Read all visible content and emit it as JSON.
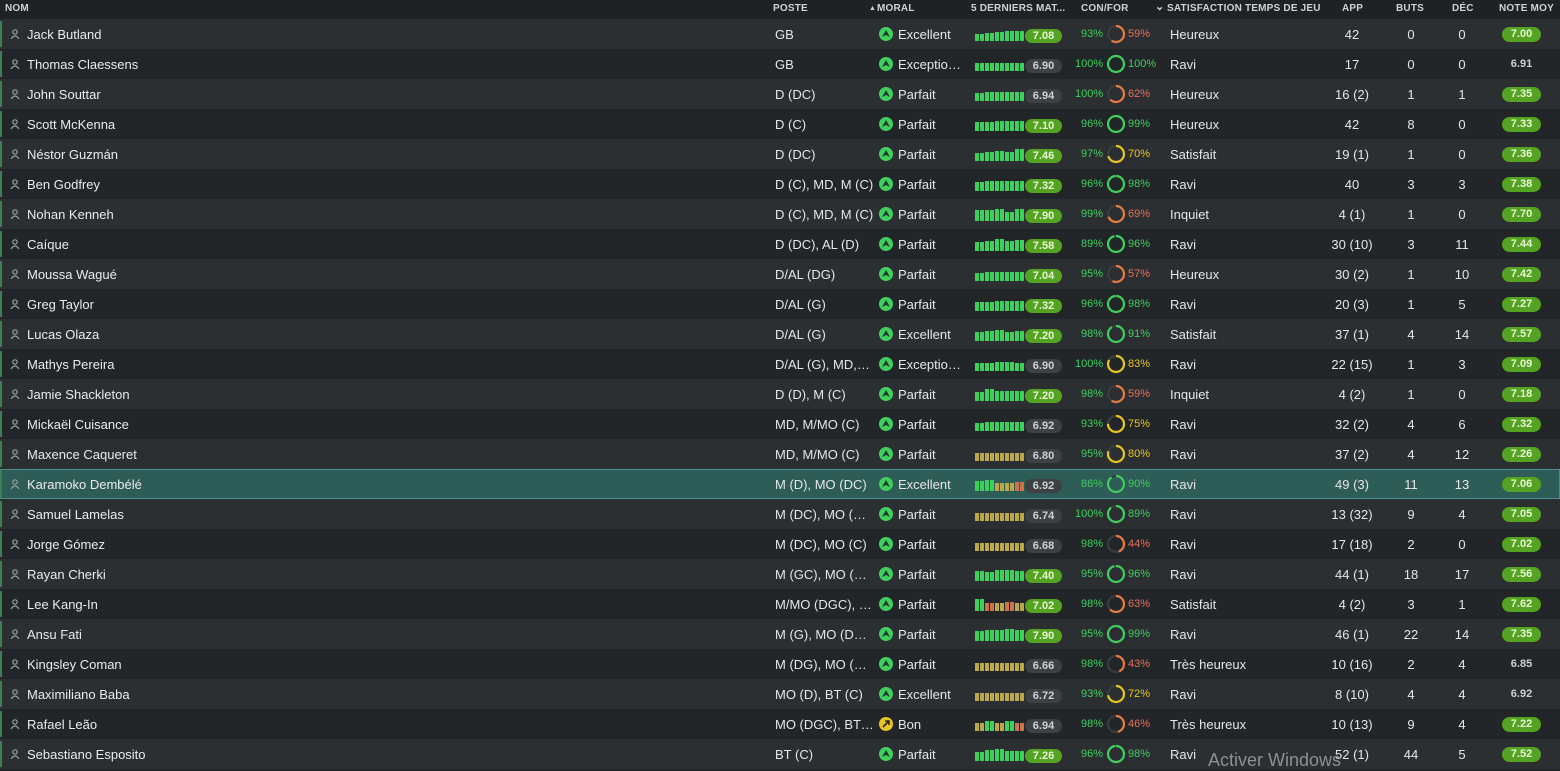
{
  "header": {
    "name": "NOM",
    "position": "POSTE",
    "morale": "MORAL",
    "morale_sort": "▲",
    "last5": "5 DERNIERS MAT...",
    "confor": "CON/FOR",
    "satisfaction_sort": "⌄",
    "satisfaction": "SATISFACTION TEMPS DE JEU",
    "apps": "APP",
    "goals": "BUTS",
    "assists": "DÉC",
    "avg": "NOTE MOY"
  },
  "colors": {
    "good": "#54a322",
    "ring_green": "#3fcf5e",
    "ring_orange": "#e87a43",
    "ring_yellow": "#e6c523"
  },
  "players": [
    {
      "name": "Jack Butland",
      "pos": "GB",
      "morale": "Excellent",
      "morale_icon": "morale-up-icon",
      "form": "7.08",
      "form_good": true,
      "bars": [
        [
          "g",
          7
        ],
        [
          "g",
          8
        ],
        [
          "g",
          9
        ],
        [
          "g",
          10
        ],
        [
          "g",
          10
        ]
      ],
      "con": "93%",
      "fit": "59%",
      "fit_level": 59,
      "sat": "Heureux",
      "app": "42",
      "goals": "0",
      "ast": "0",
      "avg": "7.00",
      "avg_good": true
    },
    {
      "name": "Thomas Claessens",
      "pos": "GB",
      "morale": "Exception…",
      "morale_icon": "morale-up-icon",
      "form": "6.90",
      "form_good": false,
      "bars": [
        [
          "g",
          8
        ],
        [
          "g",
          8
        ],
        [
          "g",
          8
        ],
        [
          "g",
          8
        ],
        [
          "g",
          8
        ]
      ],
      "con": "100%",
      "fit": "100%",
      "fit_level": 100,
      "sat": "Ravi",
      "app": "17",
      "goals": "0",
      "ast": "0",
      "avg": "6.91",
      "avg_good": false
    },
    {
      "name": "John Souttar",
      "pos": "D (DC)",
      "morale": "Parfait",
      "morale_icon": "morale-up-icon",
      "form": "6.94",
      "form_good": false,
      "bars": [
        [
          "g",
          8
        ],
        [
          "g",
          9
        ],
        [
          "g",
          9
        ],
        [
          "g",
          9
        ],
        [
          "g",
          9
        ]
      ],
      "con": "100%",
      "fit": "62%",
      "fit_level": 62,
      "sat": "Heureux",
      "app": "16 (2)",
      "goals": "1",
      "ast": "1",
      "avg": "7.35",
      "avg_good": true
    },
    {
      "name": "Scott McKenna",
      "pos": "D (C)",
      "morale": "Parfait",
      "morale_icon": "morale-up-icon",
      "form": "7.10",
      "form_good": true,
      "bars": [
        [
          "g",
          9
        ],
        [
          "g",
          9
        ],
        [
          "g",
          10
        ],
        [
          "g",
          10
        ],
        [
          "g",
          10
        ]
      ],
      "con": "96%",
      "fit": "99%",
      "fit_level": 99,
      "sat": "Heureux",
      "app": "42",
      "goals": "8",
      "ast": "0",
      "avg": "7.33",
      "avg_good": true
    },
    {
      "name": "Néstor Guzmán",
      "pos": "D (DC)",
      "morale": "Parfait",
      "morale_icon": "morale-up-icon",
      "form": "7.46",
      "form_good": true,
      "bars": [
        [
          "g",
          8
        ],
        [
          "g",
          9
        ],
        [
          "g",
          10
        ],
        [
          "g",
          9
        ],
        [
          "g",
          12
        ]
      ],
      "con": "97%",
      "fit": "70%",
      "fit_level": 70,
      "sat": "Satisfait",
      "app": "19 (1)",
      "goals": "1",
      "ast": "0",
      "avg": "7.36",
      "avg_good": true
    },
    {
      "name": "Ben Godfrey",
      "pos": "D (C), MD, M (C)",
      "morale": "Parfait",
      "morale_icon": "morale-up-icon",
      "form": "7.32",
      "form_good": true,
      "bars": [
        [
          "g",
          9
        ],
        [
          "g",
          10
        ],
        [
          "g",
          10
        ],
        [
          "g",
          10
        ],
        [
          "g",
          10
        ]
      ],
      "con": "96%",
      "fit": "98%",
      "fit_level": 98,
      "sat": "Ravi",
      "app": "40",
      "goals": "3",
      "ast": "3",
      "avg": "7.38",
      "avg_good": true
    },
    {
      "name": "Nohan Kenneh",
      "pos": "D (C), MD, M (C)",
      "morale": "Parfait",
      "morale_icon": "morale-up-icon",
      "form": "7.90",
      "form_good": true,
      "bars": [
        [
          "g",
          11
        ],
        [
          "g",
          11
        ],
        [
          "g",
          12
        ],
        [
          "g",
          9
        ],
        [
          "g",
          12
        ]
      ],
      "con": "99%",
      "fit": "69%",
      "fit_level": 69,
      "sat": "Inquiet",
      "app": "4 (1)",
      "goals": "1",
      "ast": "0",
      "avg": "7.70",
      "avg_good": true
    },
    {
      "name": "Caíque",
      "pos": "D (DC), AL (D)",
      "morale": "Parfait",
      "morale_icon": "morale-up-icon",
      "form": "7.58",
      "form_good": true,
      "bars": [
        [
          "g",
          9
        ],
        [
          "g",
          10
        ],
        [
          "g",
          12
        ],
        [
          "g",
          10
        ],
        [
          "g",
          11
        ]
      ],
      "con": "89%",
      "fit": "96%",
      "fit_level": 96,
      "sat": "Ravi",
      "app": "30 (10)",
      "goals": "3",
      "ast": "11",
      "avg": "7.44",
      "avg_good": true
    },
    {
      "name": "Moussa Wagué",
      "pos": "D/AL (DG)",
      "morale": "Parfait",
      "morale_icon": "morale-up-icon",
      "form": "7.04",
      "form_good": true,
      "bars": [
        [
          "g",
          8
        ],
        [
          "g",
          9
        ],
        [
          "g",
          9
        ],
        [
          "g",
          9
        ],
        [
          "g",
          9
        ]
      ],
      "con": "95%",
      "fit": "57%",
      "fit_level": 57,
      "sat": "Heureux",
      "app": "30 (2)",
      "goals": "1",
      "ast": "10",
      "avg": "7.42",
      "avg_good": true
    },
    {
      "name": "Greg Taylor",
      "pos": "D/AL (G)",
      "morale": "Parfait",
      "morale_icon": "morale-up-icon",
      "form": "7.32",
      "form_good": true,
      "bars": [
        [
          "g",
          9
        ],
        [
          "g",
          9
        ],
        [
          "g",
          10
        ],
        [
          "g",
          10
        ],
        [
          "g",
          10
        ]
      ],
      "con": "96%",
      "fit": "98%",
      "fit_level": 98,
      "sat": "Ravi",
      "app": "20 (3)",
      "goals": "1",
      "ast": "5",
      "avg": "7.27",
      "avg_good": true
    },
    {
      "name": "Lucas Olaza",
      "pos": "D/AL (G)",
      "morale": "Excellent",
      "morale_icon": "morale-up-icon",
      "form": "7.20",
      "form_good": true,
      "bars": [
        [
          "g",
          9
        ],
        [
          "g",
          10
        ],
        [
          "g",
          11
        ],
        [
          "g",
          9
        ],
        [
          "g",
          10
        ]
      ],
      "con": "98%",
      "fit": "91%",
      "fit_level": 91,
      "sat": "Satisfait",
      "app": "37 (1)",
      "goals": "4",
      "ast": "14",
      "avg": "7.57",
      "avg_good": true
    },
    {
      "name": "Mathys Pereira",
      "pos": "D/AL (G), MD,…",
      "morale": "Exception…",
      "morale_icon": "morale-up-icon",
      "form": "6.90",
      "form_good": false,
      "bars": [
        [
          "g",
          8
        ],
        [
          "g",
          8
        ],
        [
          "g",
          9
        ],
        [
          "g",
          9
        ],
        [
          "g",
          8
        ]
      ],
      "con": "100%",
      "fit": "83%",
      "fit_level": 83,
      "sat": "Ravi",
      "app": "22 (15)",
      "goals": "1",
      "ast": "3",
      "avg": "7.09",
      "avg_good": true
    },
    {
      "name": "Jamie Shackleton",
      "pos": "D (D), M (C)",
      "morale": "Parfait",
      "morale_icon": "morale-up-icon",
      "form": "7.20",
      "form_good": true,
      "bars": [
        [
          "g",
          9
        ],
        [
          "g",
          12
        ],
        [
          "g",
          10
        ],
        [
          "g",
          10
        ],
        [
          "g",
          10
        ]
      ],
      "con": "98%",
      "fit": "59%",
      "fit_level": 59,
      "sat": "Inquiet",
      "app": "4 (2)",
      "goals": "1",
      "ast": "0",
      "avg": "7.18",
      "avg_good": true
    },
    {
      "name": "Mickaël Cuisance",
      "pos": "MD, M/MO (C)",
      "morale": "Parfait",
      "morale_icon": "morale-up-icon",
      "form": "6.92",
      "form_good": false,
      "bars": [
        [
          "g",
          8
        ],
        [
          "g",
          9
        ],
        [
          "g",
          9
        ],
        [
          "g",
          9
        ],
        [
          "g",
          9
        ]
      ],
      "con": "93%",
      "fit": "75%",
      "fit_level": 75,
      "sat": "Ravi",
      "app": "32 (2)",
      "goals": "4",
      "ast": "6",
      "avg": "7.32",
      "avg_good": true
    },
    {
      "name": "Maxence Caqueret",
      "pos": "MD, M/MO (C)",
      "morale": "Parfait",
      "morale_icon": "morale-up-icon",
      "form": "6.80",
      "form_good": false,
      "bars": [
        [
          "y",
          8
        ],
        [
          "y",
          8
        ],
        [
          "y",
          8
        ],
        [
          "y",
          8
        ],
        [
          "y",
          8
        ]
      ],
      "con": "95%",
      "fit": "80%",
      "fit_level": 80,
      "sat": "Ravi",
      "app": "37 (2)",
      "goals": "4",
      "ast": "12",
      "avg": "7.26",
      "avg_good": true
    },
    {
      "name": "Karamoko Dembélé",
      "pos": "M (D), MO (DC)",
      "morale": "Excellent",
      "morale_icon": "morale-up-icon",
      "form": "6.92",
      "form_good": false,
      "bars": [
        [
          "g",
          10
        ],
        [
          "g",
          11
        ],
        [
          "y",
          8
        ],
        [
          "y",
          8
        ],
        [
          "o",
          9
        ]
      ],
      "con": "86%",
      "fit": "90%",
      "fit_level": 90,
      "sat": "Ravi",
      "app": "49 (3)",
      "goals": "11",
      "ast": "13",
      "avg": "7.06",
      "avg_good": true
    },
    {
      "name": "Samuel Lamelas",
      "pos": "M (DC), MO (C),…",
      "morale": "Parfait",
      "morale_icon": "morale-up-icon",
      "form": "6.74",
      "form_good": false,
      "bars": [
        [
          "y",
          8
        ],
        [
          "y",
          8
        ],
        [
          "y",
          8
        ],
        [
          "y",
          8
        ],
        [
          "y",
          8
        ]
      ],
      "con": "100%",
      "fit": "89%",
      "fit_level": 89,
      "sat": "Ravi",
      "app": "13 (32)",
      "goals": "9",
      "ast": "4",
      "avg": "7.05",
      "avg_good": true
    },
    {
      "name": "Jorge Gómez",
      "pos": "M (DC), MO (C)",
      "morale": "Parfait",
      "morale_icon": "morale-up-icon",
      "form": "6.68",
      "form_good": false,
      "bars": [
        [
          "y",
          8
        ],
        [
          "y",
          8
        ],
        [
          "y",
          8
        ],
        [
          "y",
          8
        ],
        [
          "y",
          8
        ]
      ],
      "con": "98%",
      "fit": "44%",
      "fit_level": 44,
      "sat": "Ravi",
      "app": "17 (18)",
      "goals": "2",
      "ast": "0",
      "avg": "7.02",
      "avg_good": true
    },
    {
      "name": "Rayan Cherki",
      "pos": "M (GC), MO (D…",
      "morale": "Parfait",
      "morale_icon": "morale-up-icon",
      "form": "7.40",
      "form_good": true,
      "bars": [
        [
          "g",
          10
        ],
        [
          "g",
          9
        ],
        [
          "g",
          11
        ],
        [
          "g",
          11
        ],
        [
          "g",
          10
        ]
      ],
      "con": "95%",
      "fit": "96%",
      "fit_level": 96,
      "sat": "Ravi",
      "app": "44 (1)",
      "goals": "18",
      "ast": "17",
      "avg": "7.56",
      "avg_good": true
    },
    {
      "name": "Lee Kang-In",
      "pos": "M/MO (DGC), B…",
      "morale": "Parfait",
      "morale_icon": "morale-up-icon",
      "form": "7.02",
      "form_good": true,
      "bars": [
        [
          "g",
          12
        ],
        [
          "o",
          8
        ],
        [
          "y",
          8
        ],
        [
          "o",
          9
        ],
        [
          "y",
          8
        ]
      ],
      "con": "98%",
      "fit": "63%",
      "fit_level": 63,
      "sat": "Satisfait",
      "app": "4 (2)",
      "goals": "3",
      "ast": "1",
      "avg": "7.62",
      "avg_good": true
    },
    {
      "name": "Ansu Fati",
      "pos": "M (G), MO (DG),…",
      "morale": "Parfait",
      "morale_icon": "morale-up-icon",
      "form": "7.90",
      "form_good": true,
      "bars": [
        [
          "g",
          10
        ],
        [
          "g",
          11
        ],
        [
          "g",
          11
        ],
        [
          "g",
          12
        ],
        [
          "g",
          11
        ]
      ],
      "con": "95%",
      "fit": "99%",
      "fit_level": 99,
      "sat": "Ravi",
      "app": "46 (1)",
      "goals": "22",
      "ast": "14",
      "avg": "7.35",
      "avg_good": true
    },
    {
      "name": "Kingsley Coman",
      "pos": "M (DG), MO (D…",
      "morale": "Parfait",
      "morale_icon": "morale-up-icon",
      "form": "6.66",
      "form_good": false,
      "bars": [
        [
          "y",
          8
        ],
        [
          "y",
          8
        ],
        [
          "y",
          8
        ],
        [
          "y",
          8
        ],
        [
          "y",
          8
        ]
      ],
      "con": "98%",
      "fit": "43%",
      "fit_level": 43,
      "sat": "Très heureux",
      "app": "10 (16)",
      "goals": "2",
      "ast": "4",
      "avg": "6.85",
      "avg_good": false
    },
    {
      "name": "Maximiliano Baba",
      "pos": "MO (D), BT (C)",
      "morale": "Excellent",
      "morale_icon": "morale-up-icon",
      "form": "6.72",
      "form_good": false,
      "bars": [
        [
          "y",
          8
        ],
        [
          "y",
          8
        ],
        [
          "y",
          8
        ],
        [
          "y",
          8
        ],
        [
          "y",
          8
        ]
      ],
      "con": "93%",
      "fit": "72%",
      "fit_level": 72,
      "sat": "Ravi",
      "app": "8 (10)",
      "goals": "4",
      "ast": "4",
      "avg": "6.92",
      "avg_good": false
    },
    {
      "name": "Rafael Leão",
      "pos": "MO (DGC), BT (…",
      "morale": "Bon",
      "morale_icon": "morale-neutral-icon",
      "form": "6.94",
      "form_good": false,
      "bars": [
        [
          "y",
          8
        ],
        [
          "g",
          10
        ],
        [
          "y",
          8
        ],
        [
          "g",
          10
        ],
        [
          "o",
          8
        ]
      ],
      "con": "98%",
      "fit": "46%",
      "fit_level": 46,
      "sat": "Très heureux",
      "app": "10 (13)",
      "goals": "9",
      "ast": "4",
      "avg": "7.22",
      "avg_good": true
    },
    {
      "name": "Sebastiano Esposito",
      "pos": "BT (C)",
      "morale": "Parfait",
      "morale_icon": "morale-up-icon",
      "form": "7.26",
      "form_good": true,
      "bars": [
        [
          "g",
          9
        ],
        [
          "g",
          11
        ],
        [
          "g",
          12
        ],
        [
          "g",
          10
        ],
        [
          "g",
          10
        ]
      ],
      "con": "96%",
      "fit": "98%",
      "fit_level": 98,
      "sat": "Ravi",
      "app": "52 (1)",
      "goals": "44",
      "ast": "5",
      "avg": "7.52",
      "avg_good": true
    }
  ],
  "watermark": "Activer Windows"
}
